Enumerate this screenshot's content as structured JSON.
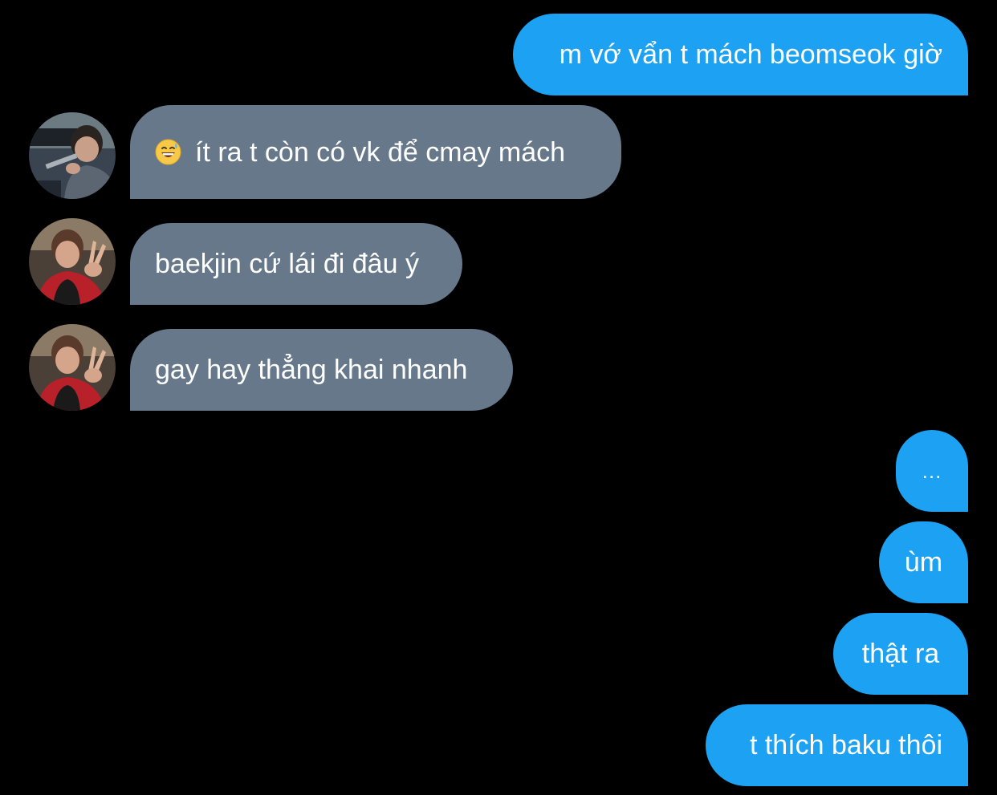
{
  "conversation": {
    "messages": [
      {
        "side": "sent",
        "text": "m vớ vẩn t mách beomseok giờ"
      },
      {
        "side": "received",
        "emoji": "grinning-sweat-emoji",
        "text": "ít ra t còn có vk để cmay mách"
      },
      {
        "side": "received",
        "text": "baekjin cứ lái đi đâu ý"
      },
      {
        "side": "received",
        "text": "gay hay thẳng khai nhanh"
      },
      {
        "side": "sent",
        "text": "..."
      },
      {
        "side": "sent",
        "text": "ùm"
      },
      {
        "side": "sent",
        "text": "thật ra"
      },
      {
        "side": "sent",
        "text": "t thích baku thôi"
      }
    ]
  },
  "colors": {
    "background": "#000000",
    "sent_bubble": "#1da1f2",
    "received_bubble": "#66788a",
    "text": "#ffffff"
  },
  "icons": {
    "avatar_1": "driver-profile-photo",
    "avatar_2": "peace-sign-profile-photo",
    "avatar_3": "peace-sign-profile-photo"
  }
}
